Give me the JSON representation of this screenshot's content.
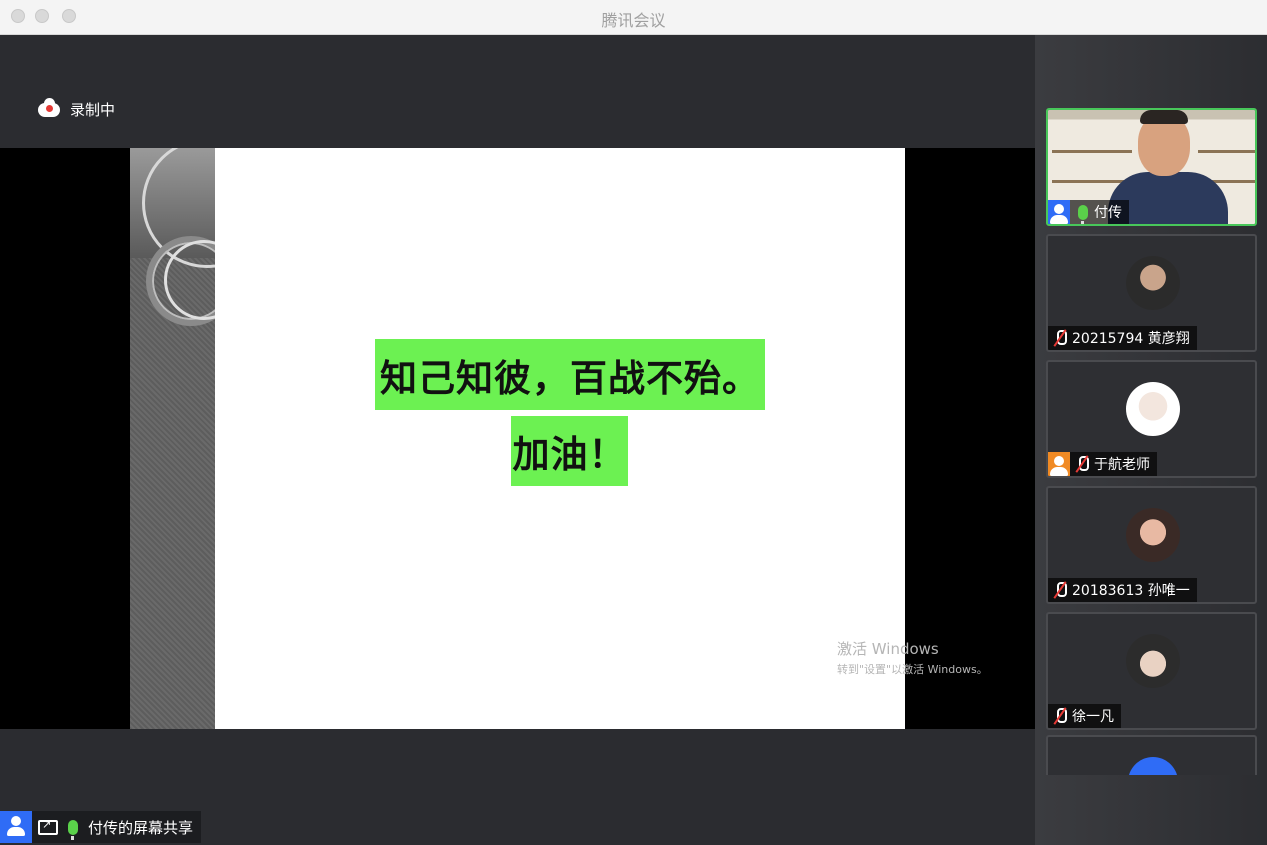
{
  "window": {
    "title": "腾讯会议"
  },
  "recording": {
    "label": "录制中"
  },
  "slide": {
    "line1": "知己知彼，百战不殆。",
    "line2": "加油！",
    "watermark_title": "激活 Windows",
    "watermark_sub": "转到\"设置\"以激活 Windows。"
  },
  "share_bar": {
    "label": "付传的屏幕共享"
  },
  "participants": [
    {
      "name": "付传",
      "mic": "on",
      "speaking": true
    },
    {
      "name": "20215794 黄彦翔",
      "mic": "muted"
    },
    {
      "name": "于航老师",
      "mic": "muted",
      "role": "host"
    },
    {
      "name": "20183613 孙唯一",
      "mic": "muted"
    },
    {
      "name": "徐一凡",
      "mic": "muted"
    }
  ],
  "colors": {
    "highlight": "#6cf152",
    "active_border": "#48c75a",
    "accent_blue": "#2f6cf6",
    "host_orange": "#f08a24"
  }
}
